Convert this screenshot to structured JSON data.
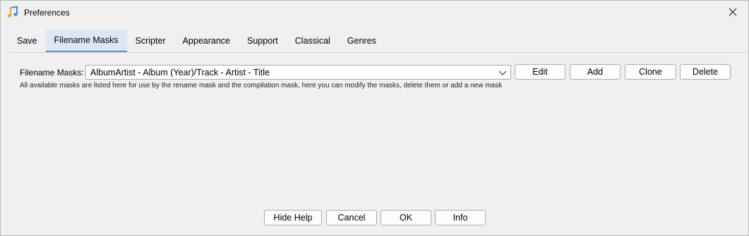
{
  "window": {
    "title": "Preferences",
    "icon": "music-note-icon"
  },
  "tabs": [
    {
      "label": "Save",
      "active": false
    },
    {
      "label": "Filename Masks",
      "active": true
    },
    {
      "label": "Scripter",
      "active": false
    },
    {
      "label": "Appearance",
      "active": false
    },
    {
      "label": "Support",
      "active": false
    },
    {
      "label": "Classical",
      "active": false
    },
    {
      "label": "Genres",
      "active": false
    }
  ],
  "masks": {
    "label": "Filename Masks:",
    "selected": "AlbumArtist - Album (Year)/Track - Artist - Title",
    "help": "All available masks are listed here for use by the rename mask and the compilation mask, here you can modify the masks, delete them or add a new mask",
    "buttons": {
      "edit": "Edit",
      "add": "Add",
      "clone": "Clone",
      "delete": "Delete"
    }
  },
  "footer": {
    "hide_help": "Hide Help",
    "cancel": "Cancel",
    "ok": "OK",
    "info": "Info"
  },
  "colors": {
    "active_tab_bg": "#dbe7f2",
    "active_tab_underline": "#5a8fc8",
    "window_bg": "#f0f0f0"
  }
}
